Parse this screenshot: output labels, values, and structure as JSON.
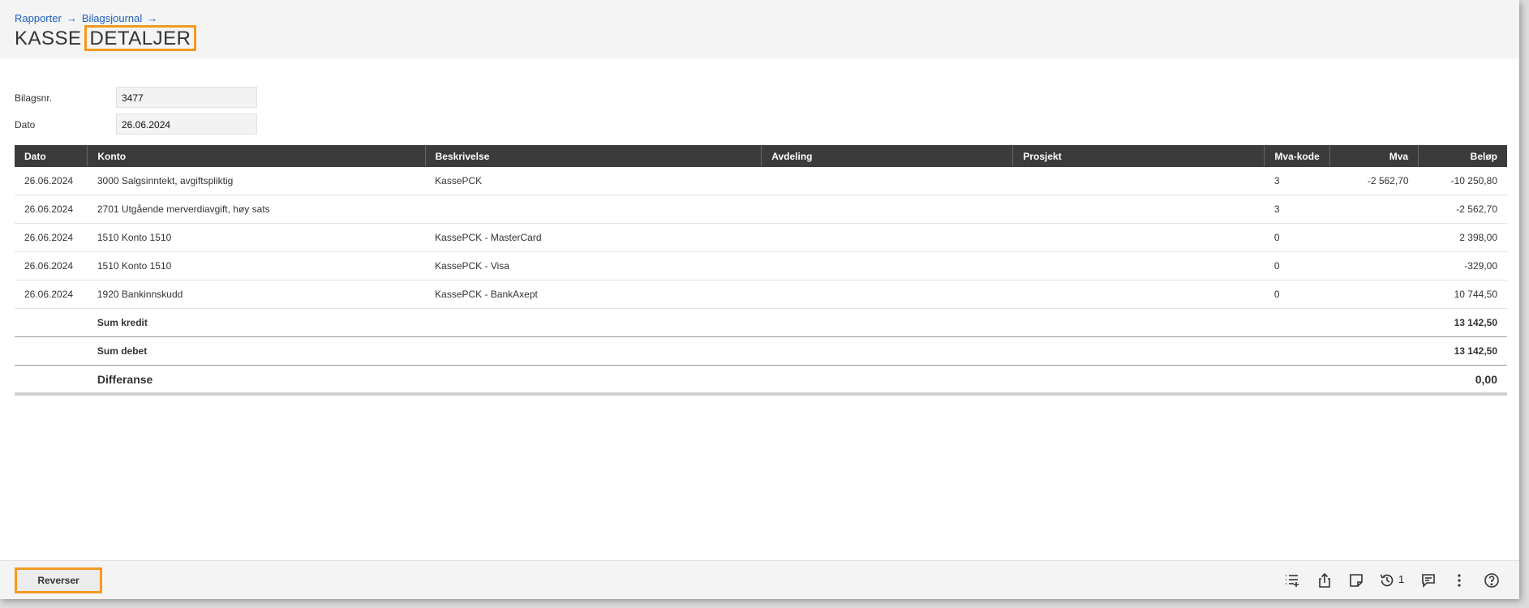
{
  "breadcrumb": {
    "items": [
      {
        "label": "Rapporter"
      },
      {
        "label": "Bilagsjournal"
      }
    ],
    "arrow": "→"
  },
  "page": {
    "title_part1": "KASSE",
    "title_part2": "DETALJER"
  },
  "fields": {
    "bilagsnr_label": "Bilagsnr.",
    "bilagsnr_value": "3477",
    "dato_label": "Dato",
    "dato_value": "26.06.2024"
  },
  "table": {
    "columns": [
      "Dato",
      "Konto",
      "Beskrivelse",
      "Avdeling",
      "Prosjekt",
      "Mva-kode",
      "Mva",
      "Beløp"
    ],
    "rows": [
      {
        "dato": "26.06.2024",
        "konto": "3000 Salgsinntekt, avgiftspliktig",
        "beskrivelse": "KassePCK",
        "avdeling": "",
        "prosjekt": "",
        "mvakode": "3",
        "mva": "-2 562,70",
        "belop": "-10 250,80"
      },
      {
        "dato": "26.06.2024",
        "konto": "2701 Utgående merverdiavgift, høy sats",
        "beskrivelse": "",
        "avdeling": "",
        "prosjekt": "",
        "mvakode": "3",
        "mva": "",
        "belop": "-2 562,70"
      },
      {
        "dato": "26.06.2024",
        "konto": "1510 Konto 1510",
        "beskrivelse": "KassePCK - MasterCard",
        "avdeling": "",
        "prosjekt": "",
        "mvakode": "0",
        "mva": "",
        "belop": "2 398,00"
      },
      {
        "dato": "26.06.2024",
        "konto": "1510 Konto 1510",
        "beskrivelse": "KassePCK - Visa",
        "avdeling": "",
        "prosjekt": "",
        "mvakode": "0",
        "mva": "",
        "belop": "-329,00"
      },
      {
        "dato": "26.06.2024",
        "konto": "1920 Bankinnskudd",
        "beskrivelse": "KassePCK - BankAxept",
        "avdeling": "",
        "prosjekt": "",
        "mvakode": "0",
        "mva": "",
        "belop": "10 744,50"
      }
    ],
    "sum_kredit_label": "Sum kredit",
    "sum_kredit_value": "13 142,50",
    "sum_debet_label": "Sum debet",
    "sum_debet_value": "13 142,50",
    "differanse_label": "Differanse",
    "differanse_value": "0,00"
  },
  "footer": {
    "reverse_label": "Reverser",
    "history_count": "1",
    "icons": [
      "list-add-icon",
      "share-icon",
      "note-icon",
      "history-icon",
      "comment-add-icon",
      "more-vertical-icon",
      "help-icon"
    ]
  },
  "colors": {
    "accent_highlight": "#f39a1f",
    "table_header_bg": "#3b3b3b",
    "link": "#1d5fbf"
  }
}
